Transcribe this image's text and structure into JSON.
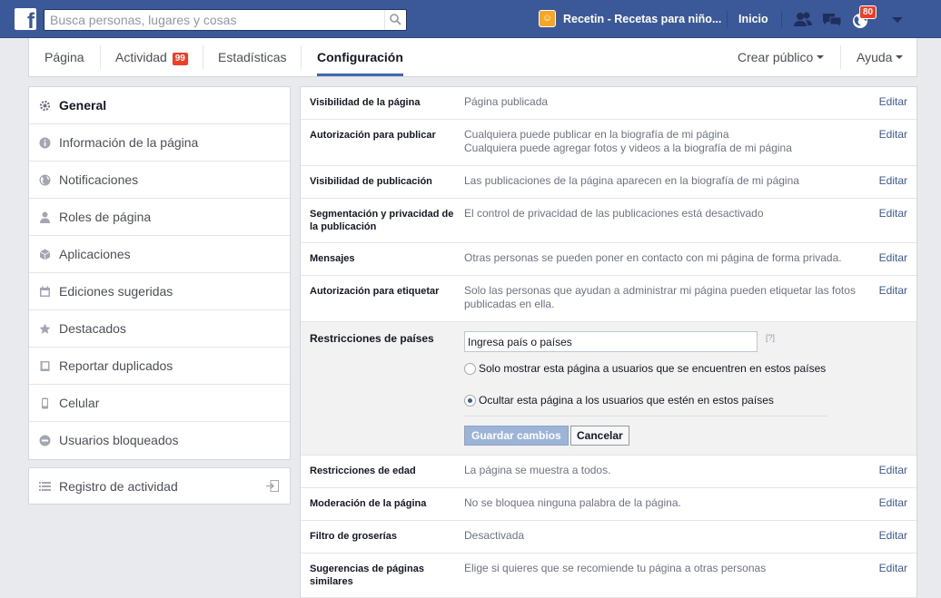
{
  "topbar": {
    "logo": "f",
    "search_placeholder": "Busca personas, lugares y cosas",
    "app_name": "Recetin - Recetas para niño...",
    "home": "Inicio",
    "notif_count": "80",
    "icons": [
      "search-icon",
      "friends-icon",
      "messages-icon",
      "globe-icon",
      "caret-down-icon"
    ]
  },
  "pagenav": {
    "tabs": [
      {
        "label": "Página"
      },
      {
        "label": "Actividad",
        "badge": "99"
      },
      {
        "label": "Estadísticas"
      },
      {
        "label": "Configuración",
        "active": true
      }
    ],
    "create_audience": "Crear público",
    "help": "Ayuda"
  },
  "sidebar": {
    "items": [
      {
        "label": "General",
        "icon": "gear-icon",
        "active": true
      },
      {
        "label": "Información de la página",
        "icon": "info-icon"
      },
      {
        "label": "Notificaciones",
        "icon": "globe-icon"
      },
      {
        "label": "Roles de página",
        "icon": "person-icon"
      },
      {
        "label": "Aplicaciones",
        "icon": "cube-icon"
      },
      {
        "label": "Ediciones sugeridas",
        "icon": "calendar-icon"
      },
      {
        "label": "Destacados",
        "icon": "star-icon"
      },
      {
        "label": "Reportar duplicados",
        "icon": "book-icon"
      },
      {
        "label": "Celular",
        "icon": "phone-icon"
      },
      {
        "label": "Usuarios bloqueados",
        "icon": "blocked-icon"
      }
    ],
    "activity_log": "Registro de actividad"
  },
  "settings": {
    "edit_label": "Editar",
    "rows": [
      {
        "name": "Visibilidad de la página",
        "value": "Página publicada"
      },
      {
        "name": "Autorización para publicar",
        "value": "Cualquiera puede publicar en la biografía de mi página\nCualquiera puede agregar fotos y videos a la biografía de mi página"
      },
      {
        "name": "Visibilidad de publicación",
        "value": "Las publicaciones de la página aparecen en la biografía de mi página"
      },
      {
        "name": "Segmentación y privacidad de la publicación",
        "value": "El control de privacidad de las publicaciones está desactivado"
      },
      {
        "name": "Mensajes",
        "value": "Otras personas se pueden poner en contacto con mi página de forma privada."
      },
      {
        "name": "Autorización para etiquetar",
        "value": "Solo las personas que ayudan a administrar mi página pueden etiquetar las fotos publicadas en ella."
      }
    ],
    "country": {
      "name": "Restricciones de países",
      "input_value": "Ingresa país o países",
      "help": "[?]",
      "option_show": "Solo mostrar esta página a usuarios que se encuentren en estos países",
      "option_hide": "Ocultar esta página a los usuarios que estén en estos países",
      "selected": "hide",
      "save": "Guardar cambios",
      "cancel": "Cancelar"
    },
    "rows_after": [
      {
        "name": "Restricciones de edad",
        "value": "La página se muestra a todos."
      },
      {
        "name": "Moderación de la página",
        "value": "No se bloquea ninguna palabra de la página."
      },
      {
        "name": "Filtro de groserías",
        "value": "Desactivada"
      },
      {
        "name": "Sugerencias de páginas similares",
        "value": "Elige si quieres que se recomiende tu página a otras personas"
      }
    ]
  },
  "colors": {
    "topbar": "#3b5998",
    "link": "#3b5998",
    "badge": "#f03d25",
    "save_button": "#9cb4d8"
  }
}
